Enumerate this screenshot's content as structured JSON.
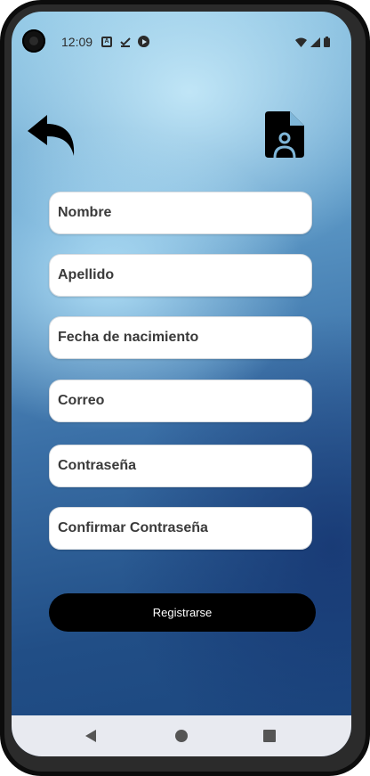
{
  "status_bar": {
    "time": "12:09",
    "notification_icons": [
      "a-icon",
      "check-download-icon",
      "play-protect-icon"
    ],
    "system_icons": [
      "wifi-icon",
      "signal-icon",
      "battery-icon"
    ]
  },
  "header": {
    "back_icon": "reply-arrow-icon",
    "doc_icon": "contact-document-icon"
  },
  "form": {
    "fields": [
      {
        "placeholder": "Nombre",
        "value": ""
      },
      {
        "placeholder": "Apellido",
        "value": ""
      },
      {
        "placeholder": "Fecha de nacimiento",
        "value": ""
      },
      {
        "placeholder": "Correo",
        "value": ""
      },
      {
        "placeholder": "Contraseña",
        "value": ""
      },
      {
        "placeholder": "Confirmar Contraseña",
        "value": ""
      }
    ],
    "submit_label": "Registrarse"
  },
  "nav_bar": {
    "buttons": [
      "back-triangle-icon",
      "home-circle-icon",
      "recents-square-icon"
    ]
  },
  "colors": {
    "button_bg": "#000000",
    "field_bg": "#ffffff",
    "background_light": "#8ec6e4",
    "background_dark": "#1b467e"
  }
}
